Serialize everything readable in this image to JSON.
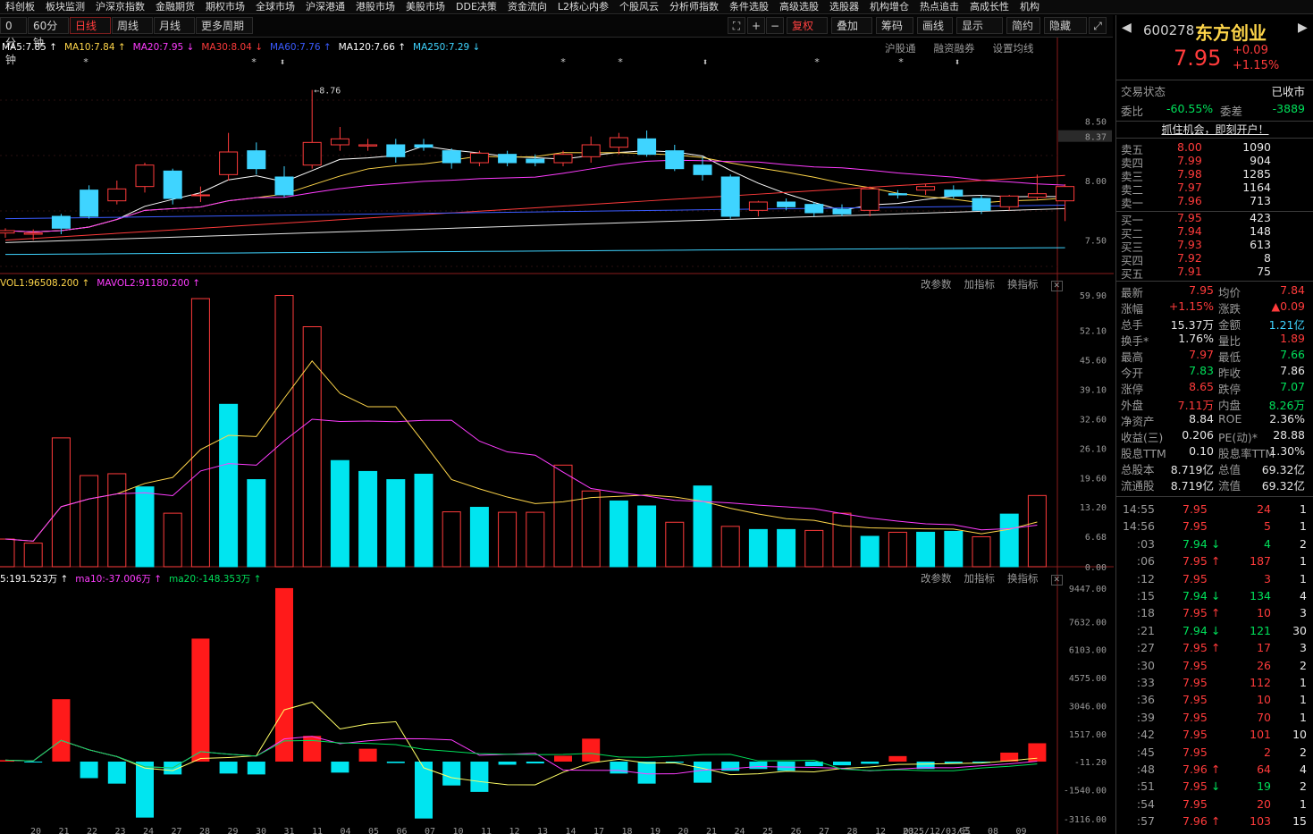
{
  "nav": [
    "科创板",
    "板块监测",
    "沪深京指数",
    "金融期货",
    "期权市场",
    "全球市场",
    "沪深港通",
    "港股市场",
    "美股市场",
    "DDE决策",
    "资金流向",
    "L2核心内参",
    "个股风云",
    "分析师指数",
    "条件选股",
    "高级选股",
    "选股器",
    "机构增仓",
    "热点追击",
    "高成长性",
    "机构"
  ],
  "toolbar": {
    "periods": [
      "0分钟",
      "60分钟",
      "日线",
      "周线",
      "月线",
      "更多周期"
    ],
    "active_period": "日线",
    "right": [
      "复权",
      "叠加",
      "筹码",
      "画线",
      "显示",
      "简约",
      "隐藏"
    ],
    "icons": [
      "box-select-icon",
      "zoom-in-icon",
      "zoom-out-icon",
      "fullscreen-icon"
    ]
  },
  "ma_legend": [
    {
      "text": "MA5:7.85",
      "color": "#ffffff",
      "arrow": "↑"
    },
    {
      "text": "MA10:7.84",
      "color": "#ffd64a",
      "arrow": "↑"
    },
    {
      "text": "MA20:7.95",
      "color": "#ff3cff",
      "arrow": "↓"
    },
    {
      "text": "MA30:8.04",
      "color": "#ff3b3b",
      "arrow": "↓"
    },
    {
      "text": "MA60:7.76",
      "color": "#3a5bff",
      "arrow": "↑"
    },
    {
      "text": "MA120:7.66",
      "color": "#ffffff",
      "arrow": "↑"
    },
    {
      "text": "MA250:7.29",
      "color": "#3fd4ff",
      "arrow": "↓"
    }
  ],
  "main_right_links": [
    "沪股通",
    "融资融券",
    "设置均线"
  ],
  "price_axis": [
    "8.50",
    "8.37",
    "8.00",
    "7.50"
  ],
  "high_marker": "8.76",
  "vol_legend": [
    {
      "text": "VOL1:96508.200",
      "color": "#ffd64a",
      "arrow": "↑"
    },
    {
      "text": "MAVOL2:91180.200",
      "color": "#ff3cff",
      "arrow": "↑"
    }
  ],
  "sub_controls": [
    "改参数",
    "加指标",
    "换指标"
  ],
  "vol_axis": [
    "59.90",
    "52.10",
    "45.60",
    "39.10",
    "32.60",
    "26.10",
    "19.60",
    "13.20",
    "6.68",
    "0.00"
  ],
  "flow_legend": [
    {
      "text": "5:191.523万",
      "color": "#ffffff",
      "arrow": "↑"
    },
    {
      "text": "ma10:-37.006万",
      "color": "#ff3cff",
      "arrow": "↑"
    },
    {
      "text": "ma20:-148.353万",
      "color": "#00e05a",
      "arrow": "↑"
    }
  ],
  "flow_axis": [
    "9447.00",
    "7632.00",
    "6103.00",
    "4575.00",
    "3046.00",
    "1517.00",
    "-11.20",
    "-1540.00",
    "-3116.00"
  ],
  "date_axis": [
    "20",
    "21",
    "22",
    "23",
    "24",
    "27",
    "28",
    "29",
    "30",
    "31",
    "11",
    "04",
    "05",
    "06",
    "07",
    "10",
    "11",
    "12",
    "13",
    "14",
    "17",
    "18",
    "19",
    "20",
    "21",
    "24",
    "25",
    "26",
    "27",
    "28",
    "12",
    "03",
    "2025/12/03/三",
    "05",
    "08",
    "09"
  ],
  "candles": [
    [
      7.56,
      7.58,
      7.52,
      7.6
    ],
    [
      7.55,
      7.56,
      7.5,
      7.59
    ],
    [
      7.7,
      7.6,
      7.55,
      7.72
    ],
    [
      7.92,
      7.7,
      7.68,
      7.96
    ],
    [
      7.83,
      7.93,
      7.8,
      8.0
    ],
    [
      7.95,
      8.13,
      7.9,
      8.15
    ],
    [
      8.08,
      7.85,
      7.8,
      8.1
    ],
    [
      7.88,
      7.88,
      7.82,
      7.95
    ],
    [
      8.05,
      8.24,
      8.0,
      8.4
    ],
    [
      8.25,
      8.1,
      8.05,
      8.32
    ],
    [
      8.03,
      7.88,
      7.86,
      8.12
    ],
    [
      8.13,
      8.32,
      8.1,
      8.76
    ],
    [
      8.3,
      8.35,
      8.25,
      8.45
    ],
    [
      8.29,
      8.3,
      8.25,
      8.35
    ],
    [
      8.3,
      8.2,
      8.15,
      8.35
    ],
    [
      8.3,
      8.28,
      8.25,
      8.35
    ],
    [
      8.25,
      8.15,
      8.1,
      8.27
    ],
    [
      8.15,
      8.23,
      8.12,
      8.25
    ],
    [
      8.22,
      8.15,
      8.12,
      8.25
    ],
    [
      8.18,
      8.15,
      8.12,
      8.22
    ],
    [
      8.15,
      8.22,
      8.12,
      8.25
    ],
    [
      8.2,
      8.3,
      8.15,
      8.37
    ],
    [
      8.28,
      8.36,
      8.22,
      8.4
    ],
    [
      8.35,
      8.22,
      8.2,
      8.42
    ],
    [
      8.25,
      8.1,
      8.08,
      8.3
    ],
    [
      8.13,
      8.05,
      8.0,
      8.2
    ],
    [
      8.03,
      7.7,
      7.68,
      8.05
    ],
    [
      7.75,
      7.82,
      7.7,
      7.83
    ],
    [
      7.82,
      7.78,
      7.75,
      7.85
    ],
    [
      7.8,
      7.73,
      7.7,
      7.82
    ],
    [
      7.76,
      7.72,
      7.7,
      7.8
    ],
    [
      7.75,
      7.93,
      7.7,
      7.95
    ],
    [
      7.89,
      7.88,
      7.85,
      7.92
    ],
    [
      7.92,
      7.95,
      7.88,
      7.97
    ],
    [
      7.92,
      7.87,
      7.85,
      7.96
    ],
    [
      7.85,
      7.75,
      7.72,
      7.88
    ],
    [
      7.78,
      7.87,
      7.75,
      7.88
    ],
    [
      7.86,
      7.89,
      7.84,
      8.05
    ],
    [
      7.83,
      7.95,
      7.66,
      7.97
    ]
  ],
  "volumes": [
    6.1,
    5.2,
    28.4,
    20.1,
    20.5,
    17.6,
    11.8,
    59.1,
    35.8,
    19.2,
    59.8,
    52.9,
    23.4,
    21.0,
    19.2,
    20.4,
    12.1,
    13.1,
    12.0,
    12.0,
    22.4,
    16.7,
    14.5,
    13.4,
    9.8,
    17.8,
    8.9,
    8.2,
    8.2,
    8.0,
    11.8,
    6.7,
    7.6,
    7.6,
    7.8,
    6.6,
    11.6,
    15.7
  ],
  "vol_up": [
    true,
    true,
    true,
    true,
    true,
    false,
    true,
    true,
    false,
    false,
    true,
    true,
    false,
    false,
    false,
    false,
    true,
    false,
    true,
    true,
    true,
    true,
    false,
    false,
    true,
    false,
    true,
    false,
    false,
    true,
    true,
    false,
    true,
    false,
    false,
    true,
    false,
    true
  ],
  "flow": [
    80,
    -10,
    3400,
    -900,
    -1200,
    -3050,
    -700,
    6700,
    -650,
    -700,
    9450,
    1400,
    -600,
    700,
    -80,
    -3100,
    -1300,
    -1650,
    -170,
    -100,
    320,
    1250,
    -650,
    -1200,
    -60,
    -1150,
    -500,
    -400,
    -500,
    -250,
    -200,
    -120,
    300,
    -400,
    -100,
    -60,
    490,
    1000
  ],
  "quote": {
    "code": "600278",
    "name": "东方创业",
    "price": "7.95",
    "change": "+0.09",
    "pct": "+1.15%",
    "status_label": "交易状态",
    "status": "已收市",
    "wb_label": "委比",
    "wb": "-60.55%",
    "wc_label": "委差",
    "wc": "-3889",
    "banner": "抓住机会，即刻开户！"
  },
  "asks": [
    [
      "卖五",
      "8.00",
      "1090"
    ],
    [
      "卖四",
      "7.99",
      "904"
    ],
    [
      "卖三",
      "7.98",
      "1285"
    ],
    [
      "卖二",
      "7.97",
      "1164"
    ],
    [
      "卖一",
      "7.96",
      "713"
    ]
  ],
  "bids": [
    [
      "买一",
      "7.95",
      "423"
    ],
    [
      "买二",
      "7.94",
      "148"
    ],
    [
      "买三",
      "7.93",
      "613"
    ],
    [
      "买四",
      "7.92",
      "8"
    ],
    [
      "买五",
      "7.91",
      "75"
    ]
  ],
  "stats": [
    [
      "最新",
      "7.95",
      "red",
      "均价",
      "7.84",
      "red"
    ],
    [
      "涨幅",
      "+1.15%",
      "red",
      "涨跌",
      "▲0.09",
      "red"
    ],
    [
      "总手",
      "15.37万",
      "white",
      "金额",
      "1.21亿",
      "cyan"
    ],
    [
      "换手*",
      "1.76%",
      "white",
      "量比",
      "1.89",
      "red"
    ],
    [
      "最高",
      "7.97",
      "red",
      "最低",
      "7.66",
      "green"
    ],
    [
      "今开",
      "7.83",
      "green",
      "昨收",
      "7.86",
      "white"
    ],
    [
      "涨停",
      "8.65",
      "red",
      "跌停",
      "7.07",
      "green"
    ],
    [
      "外盘",
      "7.11万",
      "red",
      "内盘",
      "8.26万",
      "green"
    ],
    [
      "净资产",
      "8.84",
      "white",
      "ROE",
      "2.36%",
      "white"
    ],
    [
      "收益(三)",
      "0.206",
      "white",
      "PE(动)*",
      "28.88",
      "white"
    ],
    [
      "股息TTM",
      "0.10",
      "white",
      "股息率TTM",
      "1.30%",
      "white"
    ],
    [
      "总股本",
      "8.719亿",
      "white",
      "总值",
      "69.32亿",
      "white"
    ],
    [
      "流通股",
      "8.719亿",
      "white",
      "流值",
      "69.32亿",
      "white"
    ]
  ],
  "ticks": [
    [
      "14:55",
      "7.95",
      "",
      "24",
      "1"
    ],
    [
      "14:56",
      "7.95",
      "",
      "5",
      "1"
    ],
    [
      ":03",
      "7.94",
      "down",
      "4",
      "2"
    ],
    [
      ":06",
      "7.95",
      "up",
      "187",
      "1"
    ],
    [
      ":12",
      "7.95",
      "",
      "3",
      "1"
    ],
    [
      ":15",
      "7.94",
      "down",
      "134",
      "4"
    ],
    [
      ":18",
      "7.95",
      "up",
      "10",
      "3"
    ],
    [
      ":21",
      "7.94",
      "down",
      "121",
      "30"
    ],
    [
      ":27",
      "7.95",
      "up",
      "17",
      "3"
    ],
    [
      ":30",
      "7.95",
      "",
      "26",
      "2"
    ],
    [
      ":33",
      "7.95",
      "",
      "112",
      "1"
    ],
    [
      ":36",
      "7.95",
      "",
      "10",
      "1"
    ],
    [
      ":39",
      "7.95",
      "",
      "70",
      "1"
    ],
    [
      ":42",
      "7.95",
      "",
      "101",
      "10"
    ],
    [
      ":45",
      "7.95",
      "",
      "2",
      "2"
    ],
    [
      ":48",
      "7.96",
      "up",
      "64",
      "4"
    ],
    [
      ":51",
      "7.95",
      "down",
      "19",
      "2"
    ],
    [
      ":54",
      "7.95",
      "",
      "20",
      "1"
    ],
    [
      ":57",
      "7.96",
      "up",
      "103",
      "15"
    ]
  ]
}
